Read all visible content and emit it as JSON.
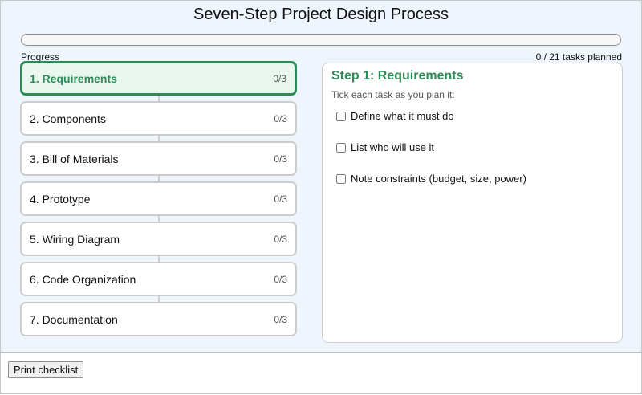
{
  "title": "Seven-Step Project Design Process",
  "progress": {
    "label": "Progress",
    "count_text": "0 / 21 tasks planned",
    "fraction": 0
  },
  "steps": [
    {
      "label": "1. Requirements",
      "count": "0/3",
      "active": true
    },
    {
      "label": "2. Components",
      "count": "0/3",
      "active": false
    },
    {
      "label": "3. Bill of Materials",
      "count": "0/3",
      "active": false
    },
    {
      "label": "4. Prototype",
      "count": "0/3",
      "active": false
    },
    {
      "label": "5. Wiring Diagram",
      "count": "0/3",
      "active": false
    },
    {
      "label": "6. Code Organization",
      "count": "0/3",
      "active": false
    },
    {
      "label": "7. Documentation",
      "count": "0/3",
      "active": false
    }
  ],
  "panel": {
    "heading": "Step 1: Requirements",
    "hint": "Tick each task as you plan it:",
    "tasks": [
      {
        "label": "Define what it must do",
        "checked": false
      },
      {
        "label": "List who will use it",
        "checked": false
      },
      {
        "label": "Note constraints (budget, size, power)",
        "checked": false
      }
    ]
  },
  "footer": {
    "print_label": "Print checklist"
  },
  "colors": {
    "accent": "#2e8b57",
    "background": "#eef5fd"
  }
}
